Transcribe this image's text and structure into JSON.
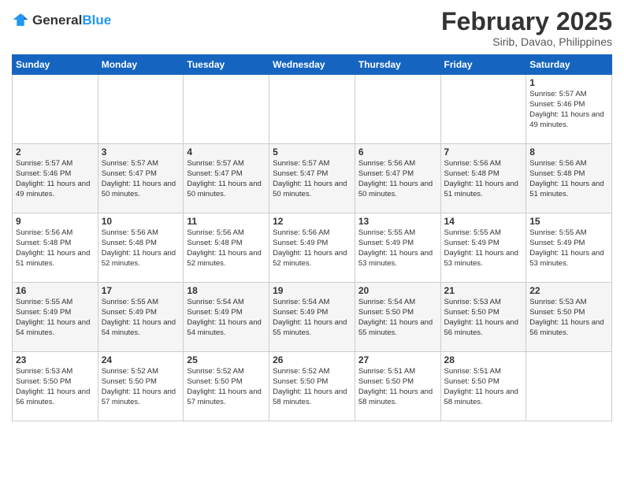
{
  "header": {
    "logo_general": "General",
    "logo_blue": "Blue",
    "month_title": "February 2025",
    "location": "Sirib, Davao, Philippines"
  },
  "days_of_week": [
    "Sunday",
    "Monday",
    "Tuesday",
    "Wednesday",
    "Thursday",
    "Friday",
    "Saturday"
  ],
  "weeks": [
    [
      {
        "day": "",
        "info": ""
      },
      {
        "day": "",
        "info": ""
      },
      {
        "day": "",
        "info": ""
      },
      {
        "day": "",
        "info": ""
      },
      {
        "day": "",
        "info": ""
      },
      {
        "day": "",
        "info": ""
      },
      {
        "day": "1",
        "info": "Sunrise: 5:57 AM\nSunset: 5:46 PM\nDaylight: 11 hours\nand 49 minutes."
      }
    ],
    [
      {
        "day": "2",
        "info": "Sunrise: 5:57 AM\nSunset: 5:46 PM\nDaylight: 11 hours\nand 49 minutes."
      },
      {
        "day": "3",
        "info": "Sunrise: 5:57 AM\nSunset: 5:47 PM\nDaylight: 11 hours\nand 50 minutes."
      },
      {
        "day": "4",
        "info": "Sunrise: 5:57 AM\nSunset: 5:47 PM\nDaylight: 11 hours\nand 50 minutes."
      },
      {
        "day": "5",
        "info": "Sunrise: 5:57 AM\nSunset: 5:47 PM\nDaylight: 11 hours\nand 50 minutes."
      },
      {
        "day": "6",
        "info": "Sunrise: 5:56 AM\nSunset: 5:47 PM\nDaylight: 11 hours\nand 50 minutes."
      },
      {
        "day": "7",
        "info": "Sunrise: 5:56 AM\nSunset: 5:48 PM\nDaylight: 11 hours\nand 51 minutes."
      },
      {
        "day": "8",
        "info": "Sunrise: 5:56 AM\nSunset: 5:48 PM\nDaylight: 11 hours\nand 51 minutes."
      }
    ],
    [
      {
        "day": "9",
        "info": "Sunrise: 5:56 AM\nSunset: 5:48 PM\nDaylight: 11 hours\nand 51 minutes."
      },
      {
        "day": "10",
        "info": "Sunrise: 5:56 AM\nSunset: 5:48 PM\nDaylight: 11 hours\nand 52 minutes."
      },
      {
        "day": "11",
        "info": "Sunrise: 5:56 AM\nSunset: 5:48 PM\nDaylight: 11 hours\nand 52 minutes."
      },
      {
        "day": "12",
        "info": "Sunrise: 5:56 AM\nSunset: 5:49 PM\nDaylight: 11 hours\nand 52 minutes."
      },
      {
        "day": "13",
        "info": "Sunrise: 5:55 AM\nSunset: 5:49 PM\nDaylight: 11 hours\nand 53 minutes."
      },
      {
        "day": "14",
        "info": "Sunrise: 5:55 AM\nSunset: 5:49 PM\nDaylight: 11 hours\nand 53 minutes."
      },
      {
        "day": "15",
        "info": "Sunrise: 5:55 AM\nSunset: 5:49 PM\nDaylight: 11 hours\nand 53 minutes."
      }
    ],
    [
      {
        "day": "16",
        "info": "Sunrise: 5:55 AM\nSunset: 5:49 PM\nDaylight: 11 hours\nand 54 minutes."
      },
      {
        "day": "17",
        "info": "Sunrise: 5:55 AM\nSunset: 5:49 PM\nDaylight: 11 hours\nand 54 minutes."
      },
      {
        "day": "18",
        "info": "Sunrise: 5:54 AM\nSunset: 5:49 PM\nDaylight: 11 hours\nand 54 minutes."
      },
      {
        "day": "19",
        "info": "Sunrise: 5:54 AM\nSunset: 5:49 PM\nDaylight: 11 hours\nand 55 minutes."
      },
      {
        "day": "20",
        "info": "Sunrise: 5:54 AM\nSunset: 5:50 PM\nDaylight: 11 hours\nand 55 minutes."
      },
      {
        "day": "21",
        "info": "Sunrise: 5:53 AM\nSunset: 5:50 PM\nDaylight: 11 hours\nand 56 minutes."
      },
      {
        "day": "22",
        "info": "Sunrise: 5:53 AM\nSunset: 5:50 PM\nDaylight: 11 hours\nand 56 minutes."
      }
    ],
    [
      {
        "day": "23",
        "info": "Sunrise: 5:53 AM\nSunset: 5:50 PM\nDaylight: 11 hours\nand 56 minutes."
      },
      {
        "day": "24",
        "info": "Sunrise: 5:52 AM\nSunset: 5:50 PM\nDaylight: 11 hours\nand 57 minutes."
      },
      {
        "day": "25",
        "info": "Sunrise: 5:52 AM\nSunset: 5:50 PM\nDaylight: 11 hours\nand 57 minutes."
      },
      {
        "day": "26",
        "info": "Sunrise: 5:52 AM\nSunset: 5:50 PM\nDaylight: 11 hours\nand 58 minutes."
      },
      {
        "day": "27",
        "info": "Sunrise: 5:51 AM\nSunset: 5:50 PM\nDaylight: 11 hours\nand 58 minutes."
      },
      {
        "day": "28",
        "info": "Sunrise: 5:51 AM\nSunset: 5:50 PM\nDaylight: 11 hours\nand 58 minutes."
      },
      {
        "day": "",
        "info": ""
      }
    ]
  ]
}
